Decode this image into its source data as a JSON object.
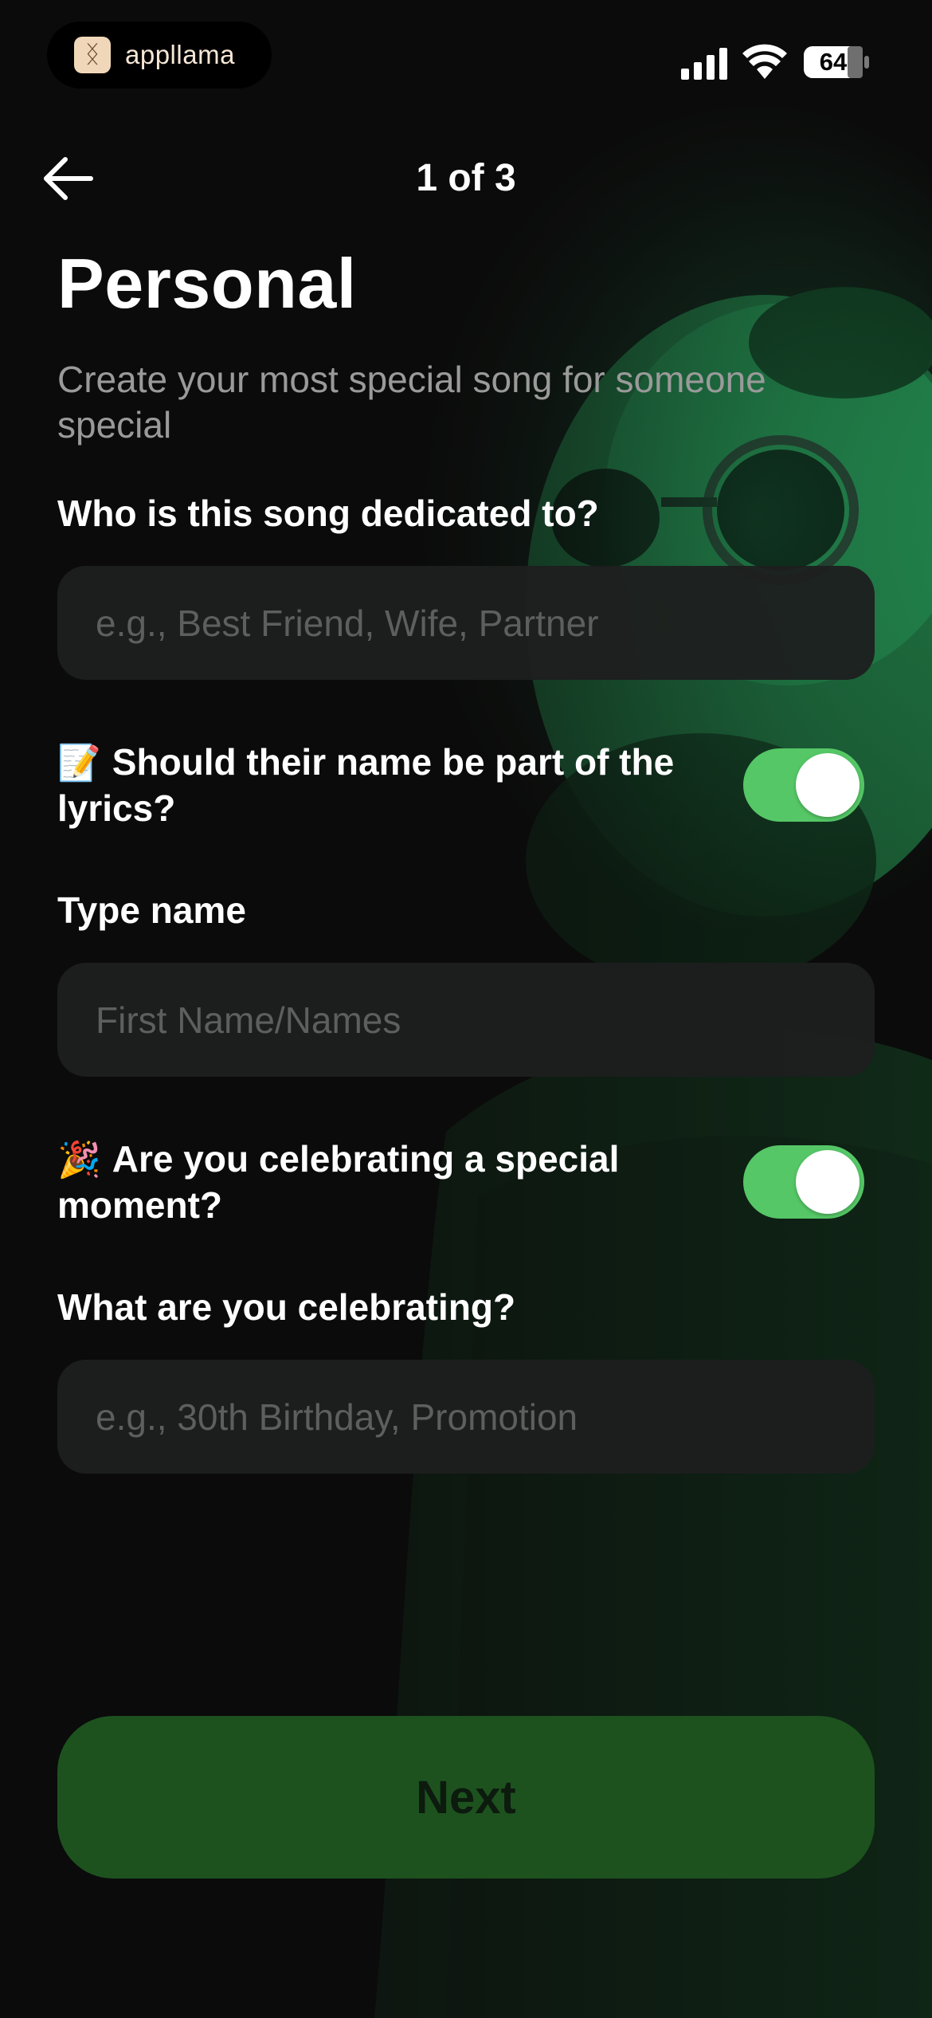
{
  "status_bar": {
    "app_pill_label": "appllama",
    "battery_level": "64"
  },
  "header": {
    "step_text": "1 of 3"
  },
  "page": {
    "title": "Personal",
    "subtitle": "Create your most special song for someone special"
  },
  "form": {
    "dedicated_label": "Who is this song dedicated to?",
    "dedicated_placeholder": "e.g., Best Friend, Wife, Partner",
    "name_question_emoji": "📝",
    "name_question": "Should their name be part of the lyrics?",
    "name_toggle_on": true,
    "type_name_label": "Type name",
    "type_name_placeholder": "First Name/Names",
    "celebrate_question_emoji": "🎉",
    "celebrate_question": "Are you celebrating a special moment?",
    "celebrate_toggle_on": true,
    "celebrate_label": "What are you celebrating?",
    "celebrate_placeholder": "e.g., 30th Birthday, Promotion"
  },
  "footer": {
    "next_label": "Next"
  },
  "colors": {
    "toggle_on": "#55c766",
    "next_button": "#1d521f",
    "accent_glow": "#2fd07a"
  },
  "icons": {
    "back": "arrow-left-icon",
    "signal": "cellular-signal-icon",
    "wifi": "wifi-icon",
    "battery": "battery-icon",
    "app_logo": "llama-logo-icon"
  }
}
